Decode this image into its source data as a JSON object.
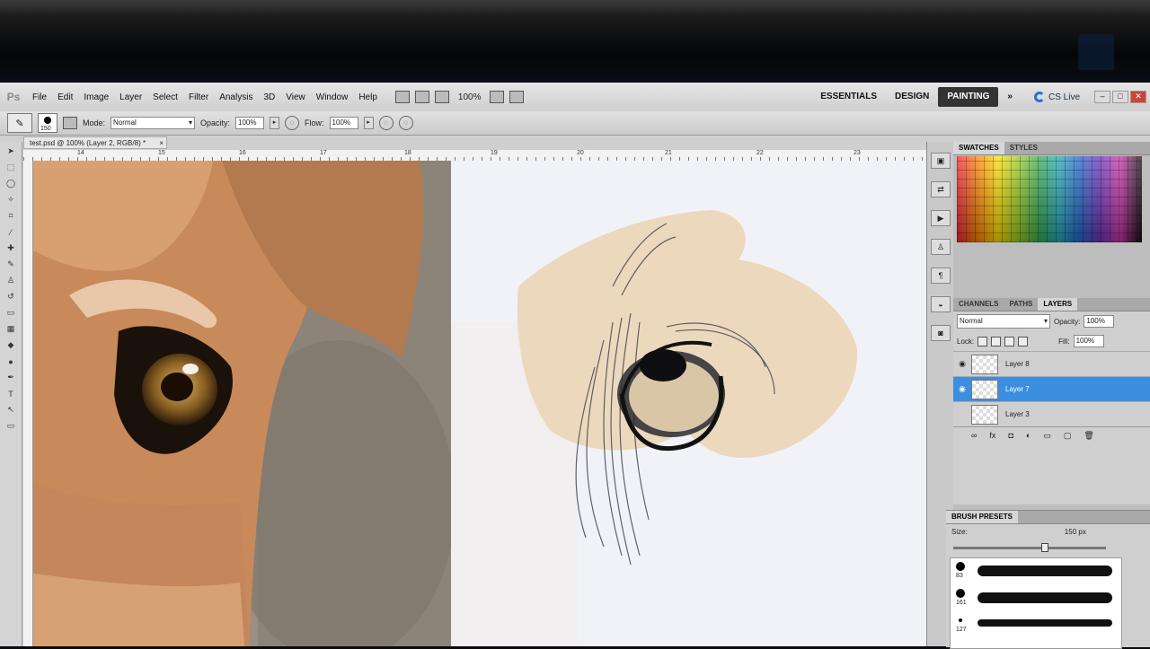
{
  "app": {
    "logo": "Ps"
  },
  "menu": [
    "File",
    "Edit",
    "Image",
    "Layer",
    "Select",
    "Filter",
    "Analysis",
    "3D",
    "View",
    "Window",
    "Help"
  ],
  "menubar": {
    "zoom": "100%"
  },
  "workspaces": {
    "essentials": "ESSENTIALS",
    "design": "DESIGN",
    "painting": "PAINTING",
    "more": "»"
  },
  "cs_live": "CS Live",
  "options": {
    "mode_label": "Mode:",
    "mode_value": "Normal",
    "opacity_label": "Opacity:",
    "opacity_value": "100%",
    "flow_label": "Flow:",
    "flow_value": "100%",
    "brush_size": "150"
  },
  "document_tab": {
    "title": "test.psd @ 100% (Layer 2, RGB/8) *",
    "close": "×"
  },
  "ruler_numbers": [
    "14",
    "15",
    "16",
    "17",
    "18",
    "19",
    "20",
    "21",
    "22",
    "23"
  ],
  "swatches_panel": {
    "tabs": [
      "SWATCHES",
      "STYLES"
    ]
  },
  "layers_panel": {
    "tabs": [
      "CHANNELS",
      "PATHS",
      "LAYERS"
    ],
    "blend_mode": "Normal",
    "opacity_label": "Opacity:",
    "opacity_value": "100%",
    "lock_label": "Lock:",
    "fill_label": "Fill:",
    "fill_value": "100%",
    "layers": [
      {
        "name": "Layer 8",
        "selected": false
      },
      {
        "name": "Layer 7",
        "selected": true
      },
      {
        "name": "Layer 3",
        "selected": false
      }
    ]
  },
  "brush_presets": {
    "title": "BRUSH PRESETS",
    "size_label": "Size:",
    "size_value": "150 px",
    "presets": [
      {
        "size": "83"
      },
      {
        "size": "161"
      },
      {
        "size": "127"
      }
    ]
  }
}
